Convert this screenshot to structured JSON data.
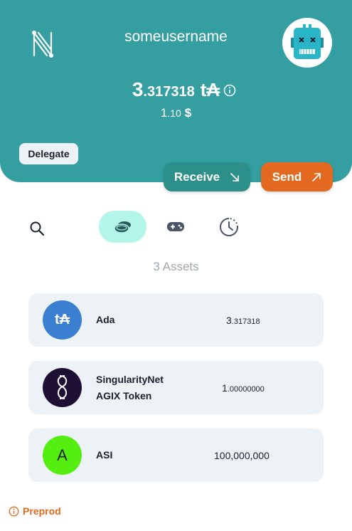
{
  "header": {
    "username": "someusername",
    "balance_int": "3",
    "balance_dec": ".317318",
    "balance_unit": "t₳",
    "fiat_int": "1",
    "fiat_dec": ".10",
    "fiat_currency": "$",
    "logo_icon": "nami-logo",
    "avatar_icon": "robot-avatar",
    "background_color": "#359ea1"
  },
  "actions": {
    "delegate_label": "Delegate",
    "receive_label": "Receive",
    "receive_icon": "arrow-down-right-icon",
    "send_label": "Send",
    "send_icon": "arrow-up-right-icon",
    "receive_color": "#2c8f8a",
    "send_color": "#e2691f"
  },
  "tabs": [
    {
      "name": "assets",
      "icon": "coins-icon",
      "active": true
    },
    {
      "name": "collectibles",
      "icon": "gamepad-icon",
      "active": false
    },
    {
      "name": "history",
      "icon": "history-icon",
      "active": false
    }
  ],
  "assets_count_label": "3 Assets",
  "assets": [
    {
      "name": "Ada",
      "name_line2": "",
      "amount_int": "3",
      "amount_dec": ".317318",
      "icon_text": "t₳",
      "icon_color": "#3a7fd0"
    },
    {
      "name": "SingularityNet",
      "name_line2": "AGIX Token",
      "amount_int": "1",
      "amount_dec": ".00000000",
      "icon_text": "",
      "icon_color": "#1e0f35"
    },
    {
      "name": "ASI",
      "name_line2": "",
      "amount_int": "100,000,000",
      "amount_dec": "",
      "icon_text": "A",
      "icon_color": "#55ee11"
    }
  ],
  "footer": {
    "network_label": "Preprod",
    "network_color": "#e2691f"
  }
}
